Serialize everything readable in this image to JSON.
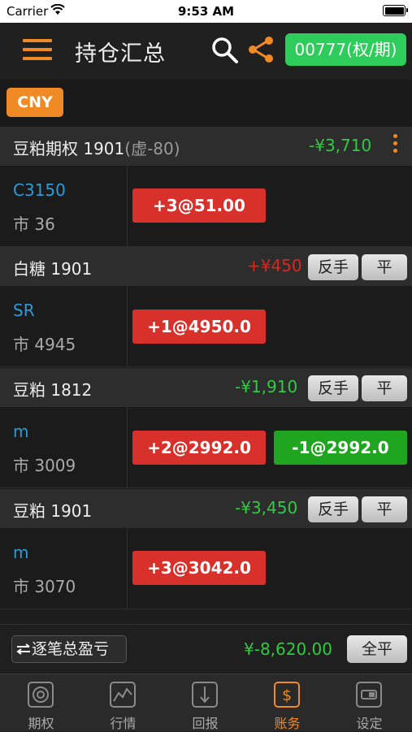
{
  "status_bar": {
    "carrier": "Carrier",
    "time": "9:53 AM"
  },
  "navbar": {
    "title": "持仓汇总",
    "account_button": "00777(权/期)"
  },
  "currency": "CNY",
  "groups": [
    {
      "name": "豆粕期权 1901",
      "virtual": "(虚-80)",
      "pnl": "-¥3,710",
      "code": "C3150",
      "market_label": "市",
      "market_price": "36",
      "positions": [
        "+3@51.00"
      ]
    },
    {
      "name": "白糖 1901",
      "pnl": "+¥450",
      "reverse_label": "反手",
      "close_label": "平",
      "code": "SR",
      "market_label": "市",
      "market_price": "4945",
      "positions": [
        "+1@4950.0"
      ]
    },
    {
      "name": "豆粕 1812",
      "pnl": "-¥1,910",
      "reverse_label": "反手",
      "close_label": "平",
      "code": "m",
      "market_label": "市",
      "market_price": "3009",
      "positions": [
        "+2@2992.0",
        "-1@2992.0"
      ]
    },
    {
      "name": "豆粕 1901",
      "pnl": "-¥3,450",
      "reverse_label": "反手",
      "close_label": "平",
      "code": "m",
      "market_label": "市",
      "market_price": "3070",
      "positions": [
        "+3@3042.0"
      ]
    }
  ],
  "footer": {
    "detail_button": "逐笔总盈亏",
    "total_pnl": "¥-8,620.00",
    "close_all": "全平"
  },
  "tabs": [
    {
      "label": "期权",
      "icon": "target-icon"
    },
    {
      "label": "行情",
      "icon": "chart-icon"
    },
    {
      "label": "回报",
      "icon": "report-icon"
    },
    {
      "label": "账务",
      "icon": "dollar-icon",
      "active": true
    },
    {
      "label": "设定",
      "icon": "settings-icon"
    }
  ],
  "colors": {
    "accent": "#f08a24",
    "profit": "#e0231b",
    "loss": "#2ecc40",
    "buy": "#d8302b",
    "sell": "#1fa51f",
    "account_button": "#2ecc5a"
  }
}
